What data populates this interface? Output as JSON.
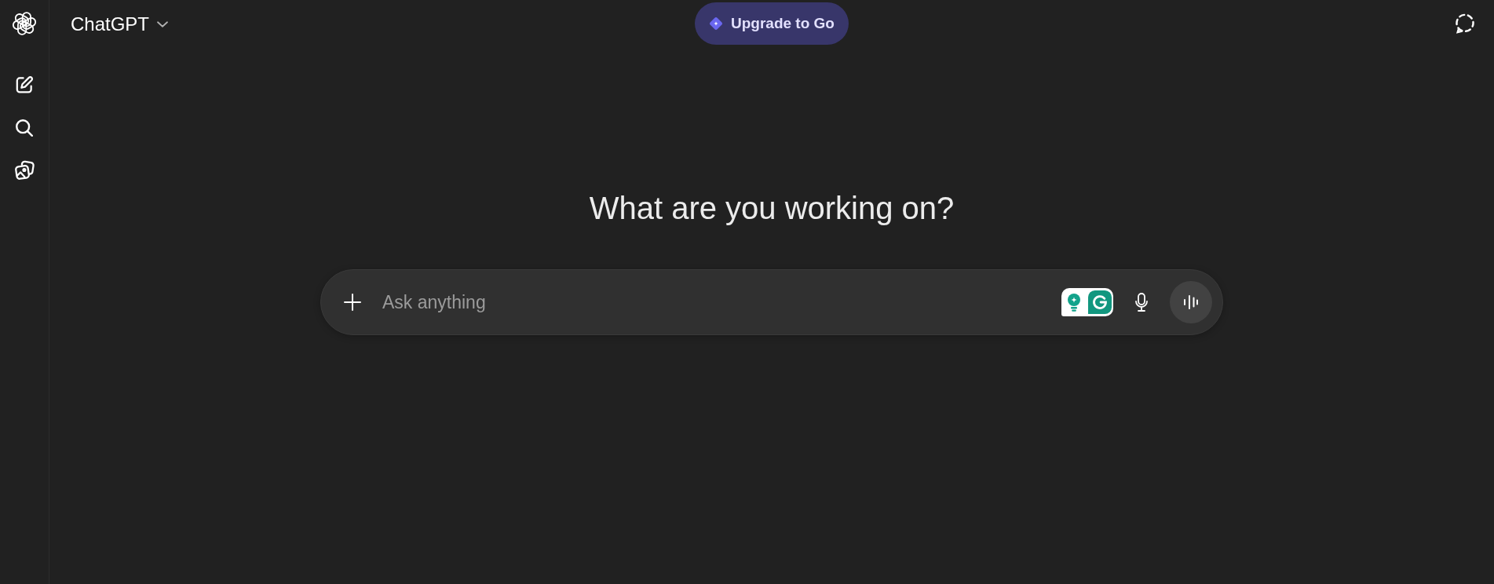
{
  "header": {
    "model_selector": "ChatGPT",
    "upgrade_button": "Upgrade to Go"
  },
  "main": {
    "heading": "What are you working on?"
  },
  "composer": {
    "placeholder": "Ask anything"
  }
}
